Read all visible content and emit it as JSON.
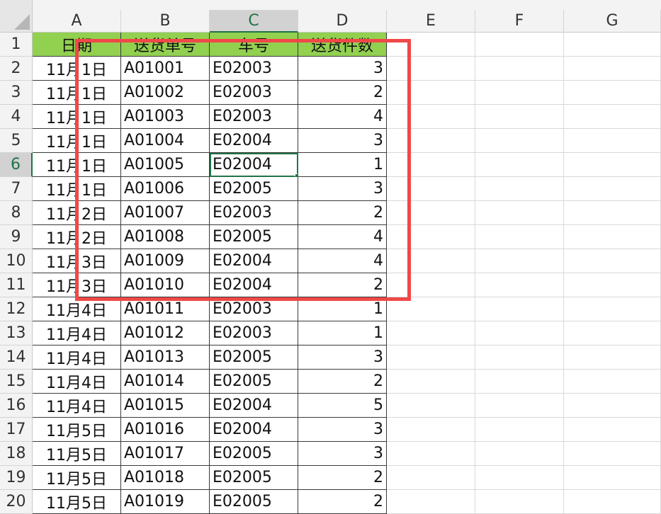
{
  "columns": [
    "A",
    "B",
    "C",
    "D",
    "E",
    "F",
    "G"
  ],
  "selected_column": "C",
  "selected_row": "6",
  "header_row": [
    "日期",
    "送货单号",
    "车号",
    "送货件数"
  ],
  "rows": [
    {
      "num": "2",
      "date": "11月1日",
      "order": "A01001",
      "car": "E02003",
      "qty": "3"
    },
    {
      "num": "3",
      "date": "11月1日",
      "order": "A01002",
      "car": "E02003",
      "qty": "2"
    },
    {
      "num": "4",
      "date": "11月1日",
      "order": "A01003",
      "car": "E02003",
      "qty": "4"
    },
    {
      "num": "5",
      "date": "11月1日",
      "order": "A01004",
      "car": "E02004",
      "qty": "3"
    },
    {
      "num": "6",
      "date": "11月1日",
      "order": "A01005",
      "car": "E02004",
      "qty": "1"
    },
    {
      "num": "7",
      "date": "11月1日",
      "order": "A01006",
      "car": "E02005",
      "qty": "3"
    },
    {
      "num": "8",
      "date": "11月2日",
      "order": "A01007",
      "car": "E02003",
      "qty": "2"
    },
    {
      "num": "9",
      "date": "11月2日",
      "order": "A01008",
      "car": "E02005",
      "qty": "4"
    },
    {
      "num": "10",
      "date": "11月3日",
      "order": "A01009",
      "car": "E02004",
      "qty": "4"
    },
    {
      "num": "11",
      "date": "11月3日",
      "order": "A01010",
      "car": "E02004",
      "qty": "2"
    },
    {
      "num": "12",
      "date": "11月4日",
      "order": "A01011",
      "car": "E02003",
      "qty": "1"
    },
    {
      "num": "13",
      "date": "11月4日",
      "order": "A01012",
      "car": "E02003",
      "qty": "1"
    },
    {
      "num": "14",
      "date": "11月4日",
      "order": "A01013",
      "car": "E02005",
      "qty": "3"
    },
    {
      "num": "15",
      "date": "11月4日",
      "order": "A01014",
      "car": "E02005",
      "qty": "2"
    },
    {
      "num": "16",
      "date": "11月4日",
      "order": "A01015",
      "car": "E02004",
      "qty": "5"
    },
    {
      "num": "17",
      "date": "11月5日",
      "order": "A01016",
      "car": "E02004",
      "qty": "3"
    },
    {
      "num": "18",
      "date": "11月5日",
      "order": "A01017",
      "car": "E02005",
      "qty": "3"
    },
    {
      "num": "19",
      "date": "11月5日",
      "order": "A01018",
      "car": "E02005",
      "qty": "2"
    },
    {
      "num": "20",
      "date": "11月5日",
      "order": "A01019",
      "car": "E02005",
      "qty": "2"
    }
  ],
  "colors": {
    "header_fill": "#92d050",
    "selection": "#217346",
    "highlight_box": "#f04848"
  }
}
